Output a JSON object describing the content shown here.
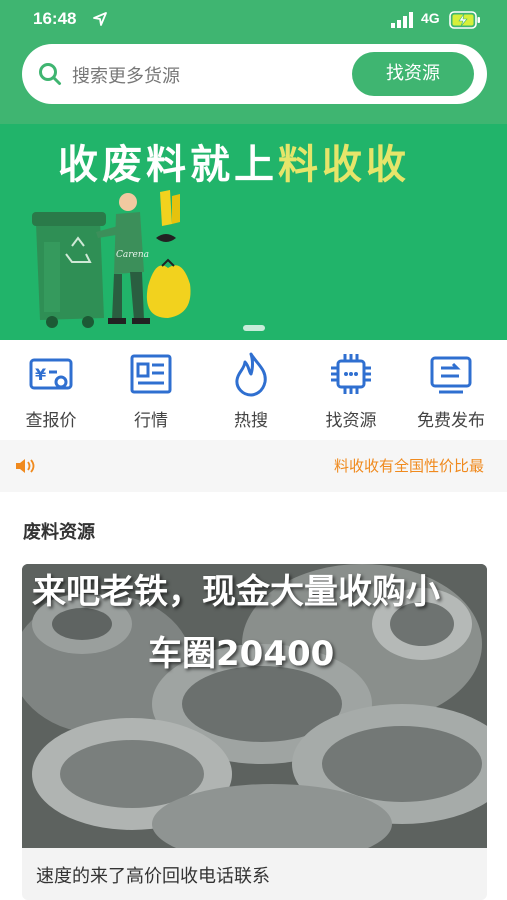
{
  "status_bar": {
    "time": "16:48",
    "network": "4G"
  },
  "search": {
    "placeholder": "搜索更多货源",
    "button_label": "找资源"
  },
  "banner": {
    "headline_main": "收废料就上",
    "headline_highlight": "料收收",
    "illus_brand": "Carena"
  },
  "quick_nav": [
    {
      "label": "查报价",
      "icon": "price-tag-icon"
    },
    {
      "label": "行情",
      "icon": "newspaper-icon"
    },
    {
      "label": "热搜",
      "icon": "flame-icon"
    },
    {
      "label": "找资源",
      "icon": "chip-icon"
    },
    {
      "label": "免费发布",
      "icon": "monitor-icon"
    }
  ],
  "notice": {
    "text": "料收收有全国性价比最"
  },
  "section": {
    "title": "废料资源",
    "card": {
      "overlay_line1": "来吧老铁，现金大量收购小",
      "overlay_line2": "车圈20400",
      "caption": "速度的来了高价回收电话联系"
    }
  },
  "colors": {
    "brand_green": "#3fb571",
    "banner_green": "#21b46a",
    "icon_blue": "#2f6fd0",
    "notice_orange": "#f08a1e"
  }
}
